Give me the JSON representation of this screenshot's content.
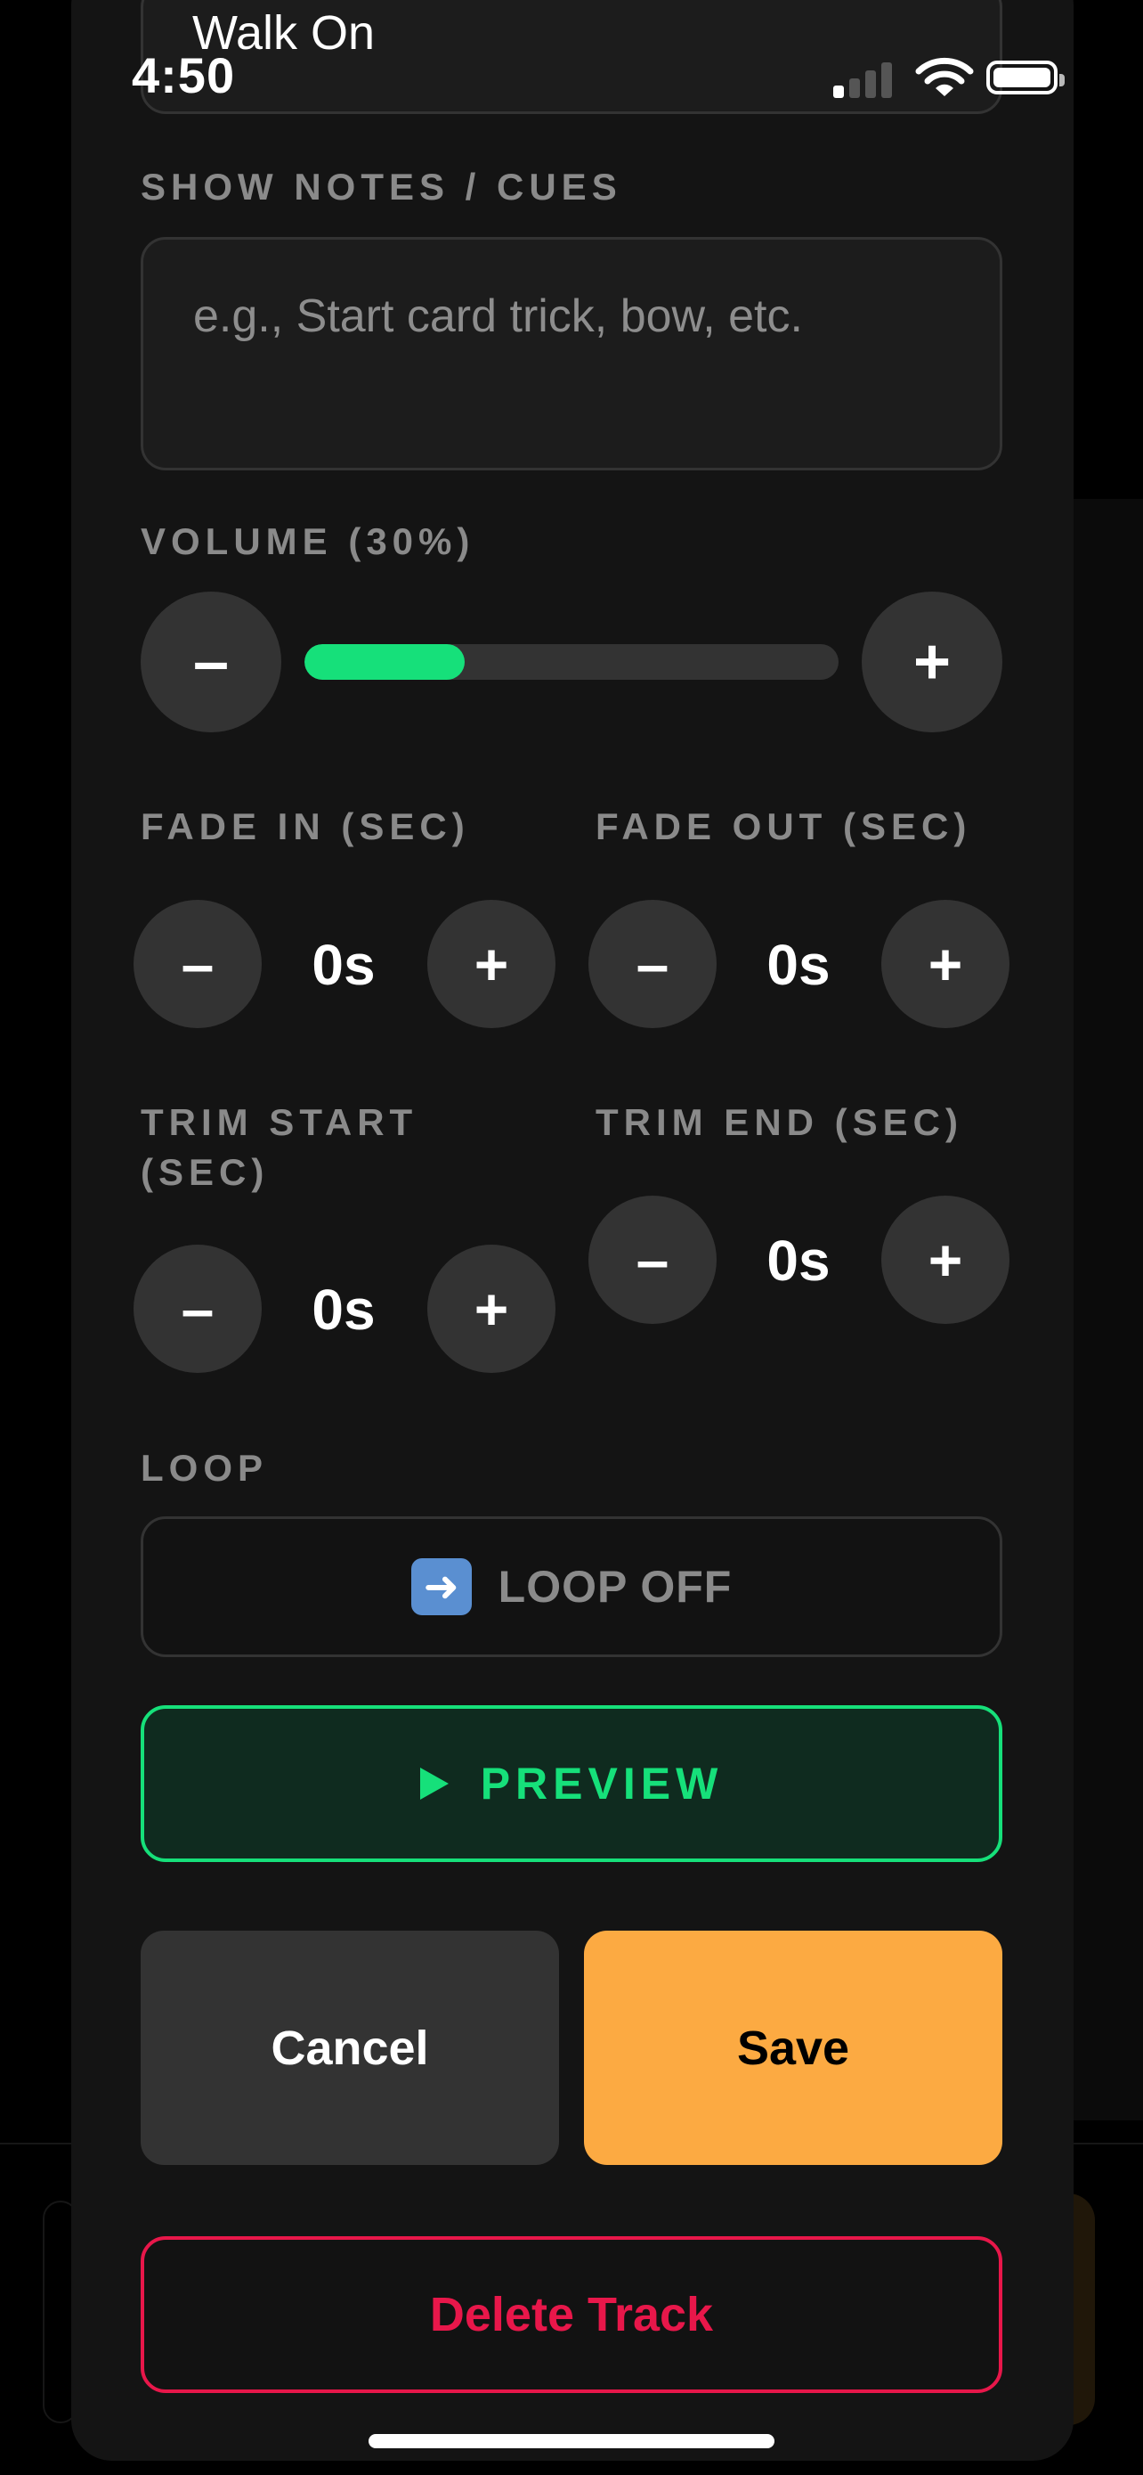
{
  "status_bar": {
    "time": "4:50",
    "signal_bars_active": 1,
    "battery_level": 1.0
  },
  "track_name": {
    "value": "Walk On"
  },
  "show_notes": {
    "label": "SHOW NOTES / CUES",
    "placeholder": "e.g., Start card trick, bow, etc."
  },
  "volume": {
    "label": "VOLUME (30%)",
    "percent": 30,
    "decrease_symbol": "–",
    "increase_symbol": "+"
  },
  "fade_in": {
    "label": "FADE IN (SEC)",
    "value": "0s",
    "decrease_symbol": "–",
    "increase_symbol": "+"
  },
  "fade_out": {
    "label": "FADE OUT (SEC)",
    "value": "0s",
    "decrease_symbol": "–",
    "increase_symbol": "+"
  },
  "trim_start": {
    "label_line1": "TRIM START",
    "label_line2": "(SEC)",
    "value": "0s",
    "decrease_symbol": "–",
    "increase_symbol": "+"
  },
  "trim_end": {
    "label": "TRIM END (SEC)",
    "value": "0s",
    "decrease_symbol": "–",
    "increase_symbol": "+"
  },
  "loop": {
    "label": "LOOP",
    "button_label": "LOOP OFF",
    "icon": "right-arrow-emoji-icon",
    "icon_glyph": "➜"
  },
  "preview": {
    "label": "PREVIEW",
    "icon": "play-icon"
  },
  "actions": {
    "cancel_label": "Cancel",
    "save_label": "Save",
    "delete_label": "Delete Track"
  },
  "colors": {
    "accent_green": "#16e07a",
    "save_orange": "#fcaa42",
    "delete_red": "#e8174a",
    "sheet_bg": "#141414",
    "control_bg": "#333333"
  }
}
